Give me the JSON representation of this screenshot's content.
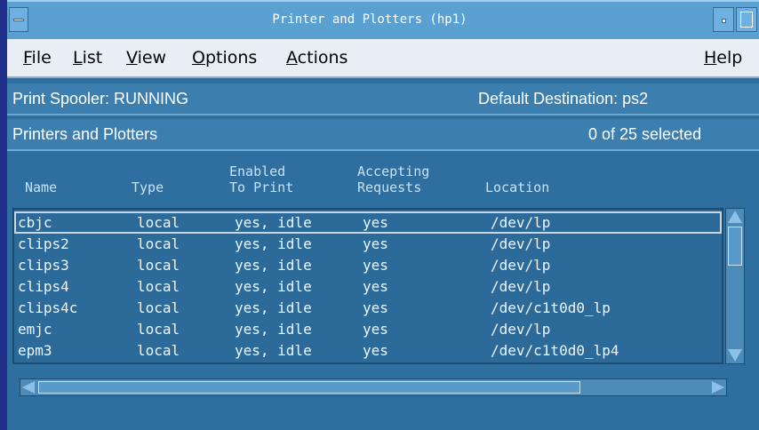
{
  "window": {
    "title": "Printer and Plotters (hp1)"
  },
  "menubar": {
    "items": [
      "File",
      "List",
      "View",
      "Options",
      "Actions"
    ],
    "help": "Help"
  },
  "spooler": {
    "status": "Print Spooler: RUNNING",
    "default_destination": "Default Destination: ps2"
  },
  "list_header": {
    "title": "Printers and Plotters",
    "selection": "0 of 25 selected"
  },
  "columns": {
    "name": "Name",
    "type": "Type",
    "enabled": [
      "Enabled",
      "To Print"
    ],
    "accepting": [
      "Accepting",
      "Requests"
    ],
    "location": "Location"
  },
  "rows": [
    {
      "name": "cbjc",
      "type": "local",
      "enabled": "yes, idle",
      "accepting": "yes",
      "location": "/dev/lp"
    },
    {
      "name": "clips2",
      "type": "local",
      "enabled": "yes, idle",
      "accepting": "yes",
      "location": "/dev/lp"
    },
    {
      "name": "clips3",
      "type": "local",
      "enabled": "yes, idle",
      "accepting": "yes",
      "location": "/dev/lp"
    },
    {
      "name": "clips4",
      "type": "local",
      "enabled": "yes, idle",
      "accepting": "yes",
      "location": "/dev/lp"
    },
    {
      "name": "clips4c",
      "type": "local",
      "enabled": "yes, idle",
      "accepting": "yes",
      "location": "/dev/c1t0d0_lp"
    },
    {
      "name": "emjc",
      "type": "local",
      "enabled": "yes, idle",
      "accepting": "yes",
      "location": "/dev/lp"
    },
    {
      "name": "epm3",
      "type": "local",
      "enabled": "yes, idle",
      "accepting": "yes",
      "location": "/dev/c1t0d0_lp4"
    }
  ],
  "colors": {
    "titlebar": "#5aa0d0",
    "background": "#2f6f9f",
    "menubar": "#e8eff4"
  }
}
